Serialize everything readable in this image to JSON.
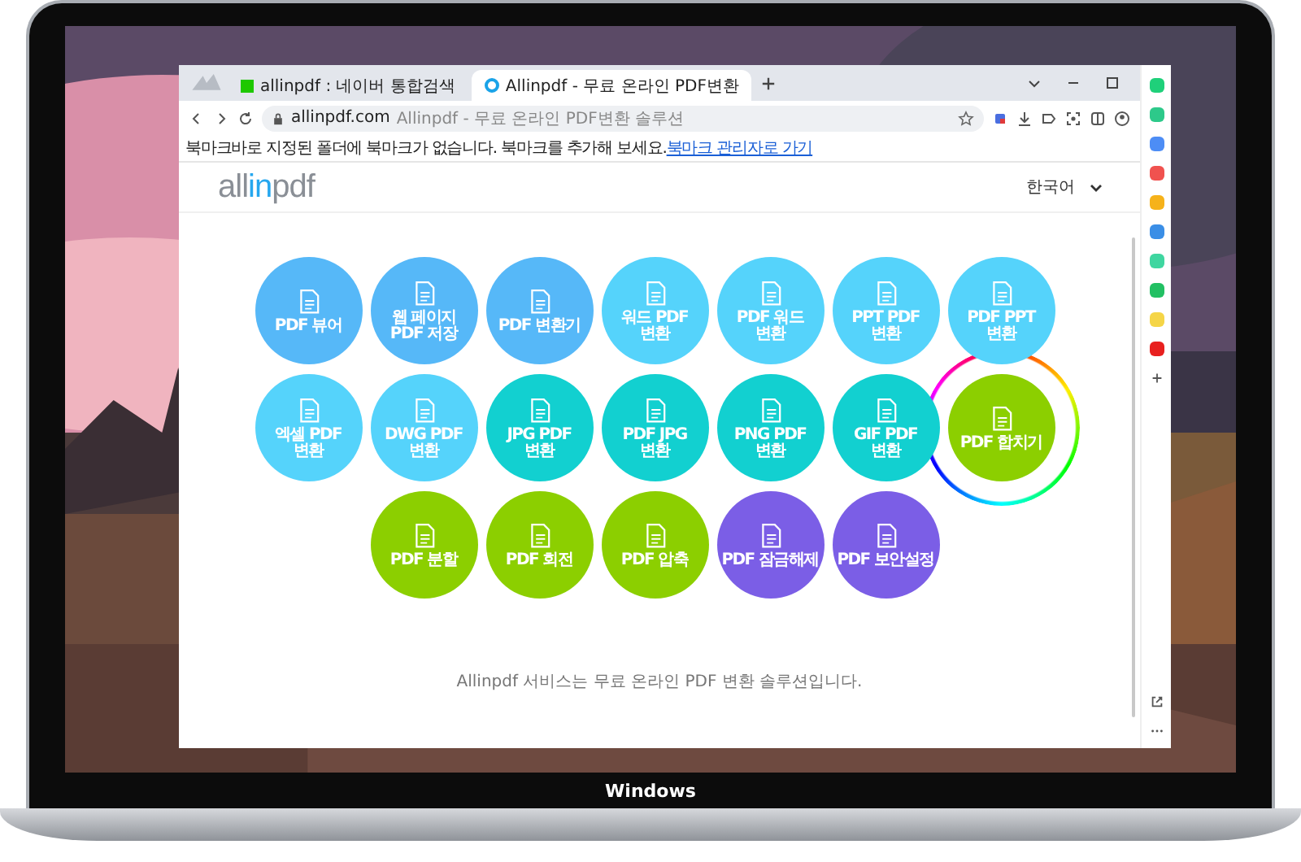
{
  "browser": {
    "tabs": [
      {
        "label": "allinpdf : 네이버 통합검색",
        "selected": false
      },
      {
        "label": "Allinpdf - 무료 온라인 PDF변환",
        "selected": true
      }
    ],
    "address": {
      "url": "allinpdf.com",
      "page_title": "Allinpdf - 무료 온라인 PDF변환 솔루션"
    },
    "bookmark_bar": {
      "message": "북마크바로 지정된 폴더에 북마크가 없습니다. 북마크를 추가해 보세요.",
      "link": "북마크 관리자로 가기"
    }
  },
  "header": {
    "logo_parts": [
      "all",
      "in",
      "pdf"
    ],
    "language": "한국어"
  },
  "tool_rows": [
    {
      "tools": [
        {
          "label": "PDF 뷰어",
          "color": "#56b8f8",
          "selected": false
        },
        {
          "label": "웹 페이지 PDF 저장",
          "color": "#56b8f8",
          "selected": false
        },
        {
          "label": "PDF 변환기",
          "color": "#56b8f8",
          "selected": false
        },
        {
          "label": "워드 PDF 변환",
          "color": "#55d3fb",
          "selected": false
        },
        {
          "label": "PDF 워드 변환",
          "color": "#55d3fb",
          "selected": false
        },
        {
          "label": "PPT PDF 변환",
          "color": "#55d3fb",
          "selected": false
        },
        {
          "label": "PDF PPT 변환",
          "color": "#55d3fb",
          "selected": false
        }
      ]
    },
    {
      "tools": [
        {
          "label": "엑셀 PDF 변환",
          "color": "#55d3fb",
          "selected": false
        },
        {
          "label": "DWG PDF 변환",
          "color": "#55d3fb",
          "selected": false
        },
        {
          "label": "JPG PDF 변환",
          "color": "#12d0d0",
          "selected": false
        },
        {
          "label": "PDF JPG 변환",
          "color": "#12d0d0",
          "selected": false
        },
        {
          "label": "PNG PDF 변환",
          "color": "#12d0d0",
          "selected": false
        },
        {
          "label": "GIF PDF 변환",
          "color": "#12d0d0",
          "selected": false
        },
        {
          "label": "PDF 합치기",
          "color": "#8ccf00",
          "selected": true
        }
      ]
    },
    {
      "tools": [
        {
          "label": "PDF 분할",
          "color": "#8ccf00",
          "selected": false
        },
        {
          "label": "PDF 회전",
          "color": "#8ccf00",
          "selected": false
        },
        {
          "label": "PDF 압축",
          "color": "#8ccf00",
          "selected": false
        },
        {
          "label": "PDF 잠금해제",
          "color": "#7b5ee6",
          "selected": false
        },
        {
          "label": "PDF 보안설정",
          "color": "#7b5ee6",
          "selected": false
        }
      ]
    }
  ],
  "footer": "Allinpdf 서비스는 무료 온라인 PDF 변환 솔루션입니다.",
  "laptop_label": "Windows"
}
